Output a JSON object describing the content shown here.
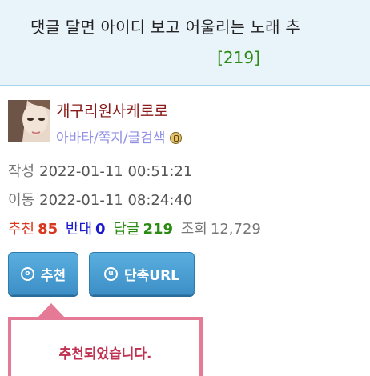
{
  "post": {
    "title": "댓글 달면 아이디 보고 어울리는 노래 추",
    "comment_count": "[219]"
  },
  "author": {
    "name": "개구리원사케로로",
    "links": "아바타/쪽지/글검색",
    "badge_icon": "level-badge-icon"
  },
  "meta": {
    "written_label": "작성",
    "written_at": "2022-01-11 00:51:21",
    "moved_label": "이동",
    "moved_at": "2022-01-11 08:24:40"
  },
  "stats": {
    "recommend_label": "추천",
    "recommend_value": "85",
    "oppose_label": "반대",
    "oppose_value": "0",
    "reply_label": "답글",
    "reply_value": "219",
    "views_label": "조회",
    "views_value": "12,729"
  },
  "buttons": {
    "recommend_icon": "ⓞ",
    "recommend_label": "추천",
    "shorturl_icon": "ⓤ",
    "shorturl_label": "단축URL"
  },
  "popup": {
    "message": "추천되었습니다."
  },
  "colors": {
    "title_bg": "#e9f3fa",
    "button_blue": "#4a9fd5",
    "popup_border": "#e57a97",
    "recommend_red": "#d9361e",
    "oppose_blue": "#1919cc",
    "reply_green": "#2a8a12"
  }
}
